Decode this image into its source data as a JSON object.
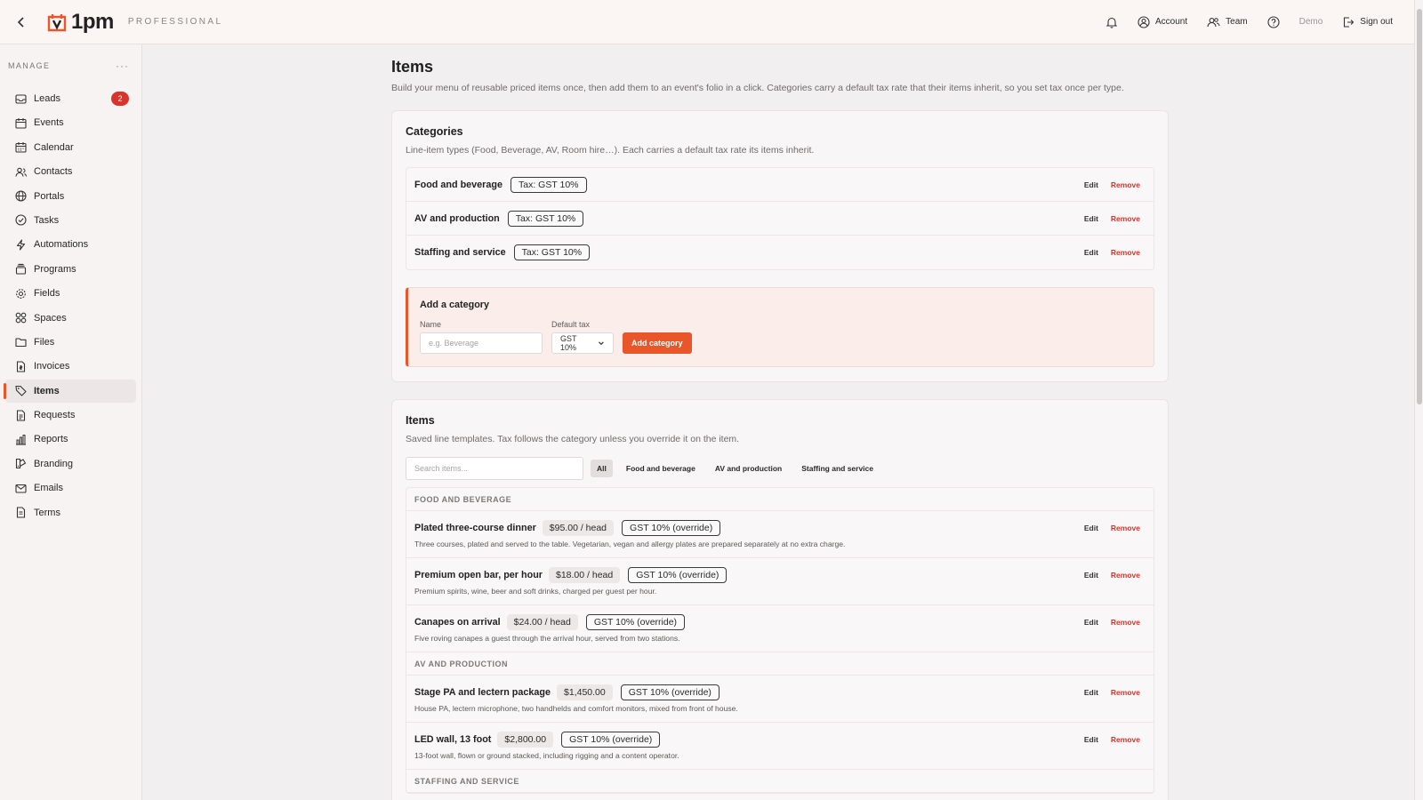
{
  "app": {
    "name": "1pm",
    "plan": "PROFESSIONAL"
  },
  "topbar": {
    "account": "Account",
    "team": "Team",
    "demo": "Demo",
    "signout": "Sign out"
  },
  "sidebar": {
    "section": "MANAGE",
    "more": "···",
    "items": [
      {
        "label": "Leads",
        "icon": "inbox-icon",
        "badge": "2"
      },
      {
        "label": "Events",
        "icon": "calendar-icon"
      },
      {
        "label": "Calendar",
        "icon": "calendar-grid-icon"
      },
      {
        "label": "Contacts",
        "icon": "contacts-icon"
      },
      {
        "label": "Portals",
        "icon": "globe-icon"
      },
      {
        "label": "Tasks",
        "icon": "check-circle-icon"
      },
      {
        "label": "Automations",
        "icon": "lightning-icon"
      },
      {
        "label": "Programs",
        "icon": "stack-icon"
      },
      {
        "label": "Fields",
        "icon": "gear-icon"
      },
      {
        "label": "Spaces",
        "icon": "grid-icon"
      },
      {
        "label": "Files",
        "icon": "folder-icon"
      },
      {
        "label": "Invoices",
        "icon": "invoice-icon"
      },
      {
        "label": "Items",
        "icon": "tag-icon",
        "active": true
      },
      {
        "label": "Requests",
        "icon": "document-icon"
      },
      {
        "label": "Reports",
        "icon": "bar-chart-icon"
      },
      {
        "label": "Branding",
        "icon": "brush-icon"
      },
      {
        "label": "Emails",
        "icon": "mail-icon"
      },
      {
        "label": "Terms",
        "icon": "terms-icon"
      }
    ]
  },
  "page": {
    "title": "Items",
    "description": "Build your menu of reusable priced items once, then add them to an event's folio in a click. Categories carry a default tax rate that their items inherit, so you set tax once per type."
  },
  "categories": {
    "title": "Categories",
    "description": "Line-item types (Food, Beverage, AV, Room hire…). Each carries a default tax rate its items inherit.",
    "rows": [
      {
        "name": "Food and beverage",
        "tax": "Tax: GST 10%"
      },
      {
        "name": "AV and production",
        "tax": "Tax: GST 10%"
      },
      {
        "name": "Staffing and service",
        "tax": "Tax: GST 10%"
      }
    ],
    "edit_label": "Edit",
    "remove_label": "Remove",
    "add": {
      "title": "Add a category",
      "name_label": "Name",
      "name_placeholder": "e.g. Beverage",
      "tax_label": "Default tax",
      "tax_value": "GST 10%",
      "button": "Add category"
    }
  },
  "items": {
    "title": "Items",
    "description": "Saved line templates. Tax follows the category unless you override it on the item.",
    "search_placeholder": "Search items...",
    "filters": [
      "All",
      "Food and beverage",
      "AV and production",
      "Staffing and service"
    ],
    "groups": [
      {
        "header": "FOOD AND BEVERAGE",
        "rows": [
          {
            "name": "Plated three-course dinner",
            "price": "$95.00 / head",
            "tax": "GST 10% (override)",
            "desc": "Three courses, plated and served to the table. Vegetarian, vegan and allergy plates are prepared separately at no extra charge."
          },
          {
            "name": "Premium open bar, per hour",
            "price": "$18.00 / head",
            "tax": "GST 10% (override)",
            "desc": "Premium spirits, wine, beer and soft drinks, charged per guest per hour."
          },
          {
            "name": "Canapes on arrival",
            "price": "$24.00 / head",
            "tax": "GST 10% (override)",
            "desc": "Five roving canapes a guest through the arrival hour, served from two stations."
          }
        ]
      },
      {
        "header": "AV AND PRODUCTION",
        "rows": [
          {
            "name": "Stage PA and lectern package",
            "price": "$1,450.00",
            "tax": "GST 10% (override)",
            "desc": "House PA, lectern microphone, two handhelds and comfort monitors, mixed from front of house."
          },
          {
            "name": "LED wall, 13 foot",
            "price": "$2,800.00",
            "tax": "GST 10% (override)",
            "desc": "13-foot wall, flown or ground stacked, including rigging and a content operator."
          }
        ]
      },
      {
        "header": "STAFFING AND SERVICE",
        "rows": []
      }
    ]
  },
  "colors": {
    "accent": "#e8562a",
    "danger": "#d9332b"
  }
}
